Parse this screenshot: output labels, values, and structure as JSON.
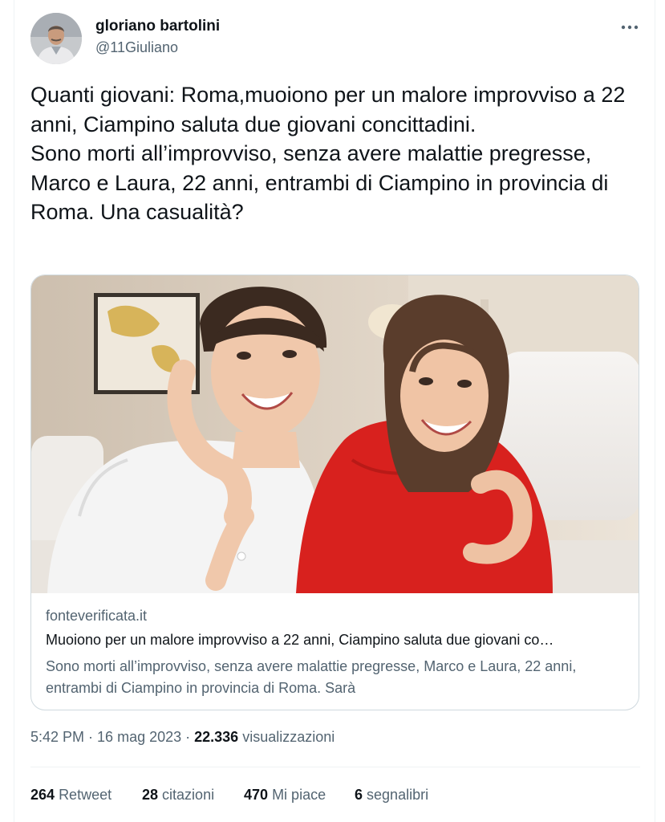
{
  "user": {
    "name": "gloriano bartolini",
    "handle": "@11Giuliano"
  },
  "menu": {
    "icon": "more-horizontal-icon"
  },
  "tweet": {
    "text": "Quanti giovani: Roma,muoiono per un malore improvviso a 22 anni, Ciampino saluta due giovani concittadini.\nSono morti all’improvviso, senza avere malattie pregresse, Marco e Laura, 22 anni, entrambi di Ciampino in provincia di Roma. Una casualità?"
  },
  "card": {
    "domain": "fonteverificata.it",
    "title": "Muoiono per un malore improvviso a 22 anni, Ciampino saluta due giovani co…",
    "description": "Sono morti all’improvviso, senza avere malattie pregresse, Marco e Laura, 22 anni, entrambi di Ciampino in provincia di Roma. Sarà"
  },
  "meta": {
    "time": "5:42 PM",
    "separator": " · ",
    "date": "16 mag 2023",
    "views_count": "22.336",
    "views_label": "visualizzazioni"
  },
  "stats": [
    {
      "count": "264",
      "label": "Retweet"
    },
    {
      "count": "28",
      "label": "citazioni"
    },
    {
      "count": "470",
      "label": "Mi piace"
    },
    {
      "count": "6",
      "label": "segnalibri"
    }
  ],
  "colors": {
    "text_primary": "#0f1419",
    "text_secondary": "#536471",
    "border": "#cfd9de",
    "shirt_red": "#d8211e"
  }
}
